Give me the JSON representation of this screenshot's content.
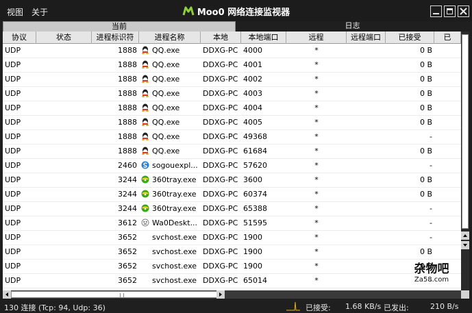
{
  "menu": {
    "view": "视图",
    "about": "关于"
  },
  "app_title": "Moo0 网络连接监视器",
  "tabs": {
    "current": "当前",
    "log": "日志"
  },
  "columns": [
    "协议",
    "状态",
    "进程标识符",
    "进程名称",
    "本地",
    "本地端口",
    "远程",
    "远程端口",
    "已接受",
    "已"
  ],
  "rows": [
    {
      "proto": "UDP",
      "state": "",
      "pid": "1888",
      "icon": "qq-icon",
      "name": "QQ.exe",
      "local": "DDXG-PC",
      "lport": "4000",
      "remote": "*",
      "rport": "",
      "recv": "0 B"
    },
    {
      "proto": "UDP",
      "state": "",
      "pid": "1888",
      "icon": "qq-icon",
      "name": "QQ.exe",
      "local": "DDXG-PC",
      "lport": "4001",
      "remote": "*",
      "rport": "",
      "recv": "0 B"
    },
    {
      "proto": "UDP",
      "state": "",
      "pid": "1888",
      "icon": "qq-icon",
      "name": "QQ.exe",
      "local": "DDXG-PC",
      "lport": "4002",
      "remote": "*",
      "rport": "",
      "recv": "0 B"
    },
    {
      "proto": "UDP",
      "state": "",
      "pid": "1888",
      "icon": "qq-icon",
      "name": "QQ.exe",
      "local": "DDXG-PC",
      "lport": "4003",
      "remote": "*",
      "rport": "",
      "recv": "0 B"
    },
    {
      "proto": "UDP",
      "state": "",
      "pid": "1888",
      "icon": "qq-icon",
      "name": "QQ.exe",
      "local": "DDXG-PC",
      "lport": "4004",
      "remote": "*",
      "rport": "",
      "recv": "0 B"
    },
    {
      "proto": "UDP",
      "state": "",
      "pid": "1888",
      "icon": "qq-icon",
      "name": "QQ.exe",
      "local": "DDXG-PC",
      "lport": "4005",
      "remote": "*",
      "rport": "",
      "recv": "0 B"
    },
    {
      "proto": "UDP",
      "state": "",
      "pid": "1888",
      "icon": "qq-icon",
      "name": "QQ.exe",
      "local": "DDXG-PC",
      "lport": "49368",
      "remote": "*",
      "rport": "",
      "recv": "-"
    },
    {
      "proto": "UDP",
      "state": "",
      "pid": "1888",
      "icon": "qq-icon",
      "name": "QQ.exe",
      "local": "DDXG-PC",
      "lport": "61684",
      "remote": "*",
      "rport": "",
      "recv": "0 B"
    },
    {
      "proto": "UDP",
      "state": "",
      "pid": "2460",
      "icon": "sogou-icon",
      "name": "sogouexpl...",
      "local": "DDXG-PC",
      "lport": "57620",
      "remote": "*",
      "rport": "",
      "recv": "-"
    },
    {
      "proto": "UDP",
      "state": "",
      "pid": "3244",
      "icon": "360tray-icon",
      "name": "360tray.exe",
      "local": "DDXG-PC",
      "lport": "3600",
      "remote": "*",
      "rport": "",
      "recv": "0 B"
    },
    {
      "proto": "UDP",
      "state": "",
      "pid": "3244",
      "icon": "360tray-icon",
      "name": "360tray.exe",
      "local": "DDXG-PC",
      "lport": "60374",
      "remote": "*",
      "rport": "",
      "recv": "0 B"
    },
    {
      "proto": "UDP",
      "state": "",
      "pid": "3244",
      "icon": "360tray-icon",
      "name": "360tray.exe",
      "local": "DDXG-PC",
      "lport": "65388",
      "remote": "*",
      "rport": "",
      "recv": "-"
    },
    {
      "proto": "UDP",
      "state": "",
      "pid": "3612",
      "icon": "wa0desktop-icon",
      "name": "Wa0Deskt...",
      "local": "DDXG-PC",
      "lport": "51595",
      "remote": "*",
      "rport": "",
      "recv": "-"
    },
    {
      "proto": "UDP",
      "state": "",
      "pid": "3652",
      "icon": "",
      "name": "svchost.exe",
      "local": "DDXG-PC",
      "lport": "1900",
      "remote": "*",
      "rport": "",
      "recv": "-"
    },
    {
      "proto": "UDP",
      "state": "",
      "pid": "3652",
      "icon": "",
      "name": "svchost.exe",
      "local": "DDXG-PC",
      "lport": "1900",
      "remote": "*",
      "rport": "",
      "recv": "0 B"
    },
    {
      "proto": "UDP",
      "state": "",
      "pid": "3652",
      "icon": "",
      "name": "svchost.exe",
      "local": "DDXG-PC",
      "lport": "1900",
      "remote": "*",
      "rport": "",
      "recv": "0 B"
    },
    {
      "proto": "UDP",
      "state": "",
      "pid": "3652",
      "icon": "",
      "name": "svchost.exe",
      "local": "DDXG-PC",
      "lport": "65014",
      "remote": "*",
      "rport": "",
      "recv": "-"
    }
  ],
  "status": {
    "connections": "130 连接 (Tcp: 94, Udp: 36)",
    "received_label": "已接受:",
    "received_value": "1.68 KB/s",
    "sent_label": "已发出:",
    "sent_value": "210 B/s"
  },
  "watermark": {
    "line1": "杂物吧",
    "line2": "Za58.com"
  },
  "colors": {
    "background": "#1f1f1f",
    "header": "#e6e6e6",
    "grid": "#ffffff",
    "qq": "#d33a1c",
    "360": "#3aa815",
    "sogou": "#2a7fd8"
  }
}
